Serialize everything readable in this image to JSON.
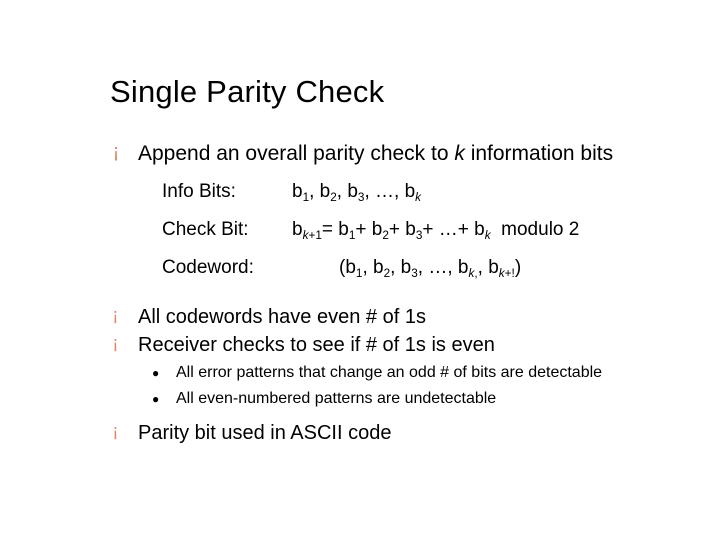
{
  "title": "Single Parity Check",
  "bullets": {
    "b0": {
      "pre": "Append an overall parity check to ",
      "k": "k",
      "post": " information bits"
    },
    "defs": {
      "info_label": "Info Bits:",
      "info_val_html": "b<sub>1</sub>, b<sub>2</sub>, b<sub>3</sub>, …, b<sub><span class='ital'>k</span></sub>",
      "check_label": "Check Bit:",
      "check_val_html": "b<sub><span class='ital'>k</span>+1</sub>= b<sub>1</sub>+ b<sub>2</sub>+ b<sub>3</sub>+ …+ b<sub><span class='ital'>k</span></sub>&nbsp;&nbsp;modulo 2",
      "code_label": "Codeword:",
      "code_val_html": "(b<sub>1</sub>, b<sub>2</sub>, b<sub>3</sub>, …, b<sub><span class='ital'>k</span>,</sub>, b<sub><span class='ital'>k</span>+!</sub>)"
    },
    "b1": "All codewords have even # of 1s",
    "b2": "Receiver checks to see if # of 1s is even",
    "sub1": "All error patterns that change an odd # of bits are detectable",
    "sub2": "All even-numbered patterns are undetectable",
    "b3": "Parity bit used in ASCII code"
  },
  "glyphs": {
    "ring": "¡",
    "dot": "●"
  }
}
